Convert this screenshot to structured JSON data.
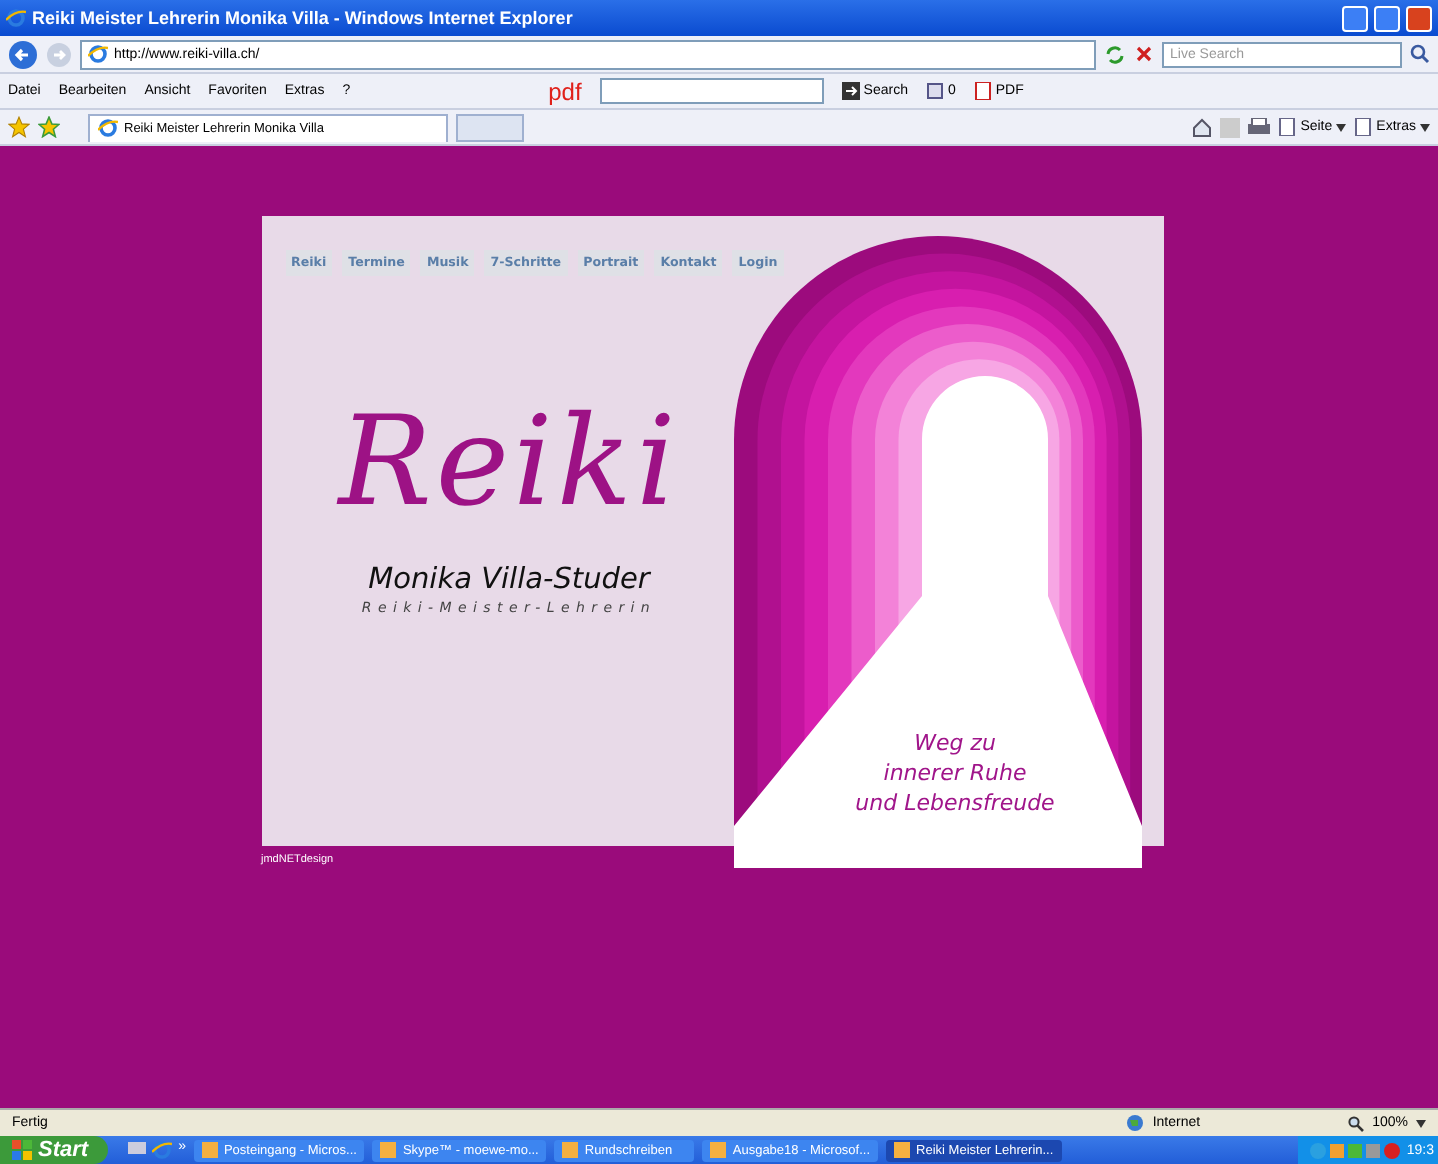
{
  "window": {
    "title": "Reiki Meister Lehrerin Monika Villa - Windows Internet Explorer"
  },
  "address_bar": {
    "url": "http://www.reiki-villa.ch/",
    "search_placeholder": "Live Search"
  },
  "menu": [
    "Datei",
    "Bearbeiten",
    "Ansicht",
    "Favoriten",
    "Extras",
    "?"
  ],
  "pdf_toolbar": {
    "logo": "pdf",
    "search_button": "Search",
    "count": "0",
    "pdf_button": "PDF"
  },
  "tab": {
    "title": "Reiki Meister Lehrerin Monika Villa"
  },
  "command_bar": [
    "Seite",
    "Extras"
  ],
  "page": {
    "nav": [
      "Reiki",
      "Termine",
      "Musik",
      "7-Schritte",
      "Portrait",
      "Kontakt",
      "Login"
    ],
    "logo": "Reiki",
    "name": "Monika Villa-Studer",
    "subtitle": "Reiki-Meister-Lehrerin",
    "tagline": [
      "Weg zu",
      "innerer Ruhe",
      "und Lebensfreude"
    ],
    "credit": "jmdNETdesign"
  },
  "status_bar": {
    "text": "Fertig",
    "zone": "Internet",
    "zoom": "100%"
  },
  "taskbar": {
    "start": "Start",
    "quicklaunch_more": "»",
    "tasks": [
      {
        "label": "Posteingang - Micros...",
        "selected": false
      },
      {
        "label": "Skype™ - moewe-mo...",
        "selected": false
      },
      {
        "label": "Rundschreiben",
        "selected": false
      },
      {
        "label": "Ausgabe18 - Microsof...",
        "selected": false
      },
      {
        "label": "Reiki Meister Lehrerin...",
        "selected": true
      }
    ],
    "clock": "19:3"
  }
}
